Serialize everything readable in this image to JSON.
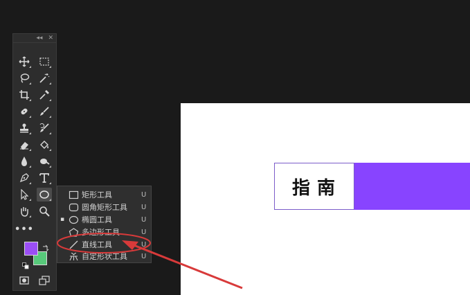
{
  "colors": {
    "app_bg": "#1a1a1a",
    "panel": "#2d2d2d",
    "foreground": "#9b4ef5",
    "background": "#57c97a",
    "canvas": "#ffffff",
    "purple_bar": "#8844ff",
    "annotation": "#d83a3a"
  },
  "toolbox": {
    "collapse_icon": "double-arrow-icon",
    "close_icon": "close-icon",
    "tools": [
      "move-icon",
      "marquee-icon",
      "lasso-icon",
      "magic-wand-icon",
      "crop-icon",
      "eyedropper-icon",
      "healing-brush-icon",
      "brush-icon",
      "stamp-icon",
      "history-brush-icon",
      "eraser-icon",
      "paint-bucket-icon",
      "blur-icon",
      "dodge-icon",
      "pen-icon",
      "type-icon",
      "path-select-icon",
      "ellipse-icon",
      "hand-icon",
      "zoom-icon"
    ],
    "more": "•••"
  },
  "flyout": {
    "items": [
      {
        "label": "矩形工具",
        "shortcut": "U",
        "icon": "rectangle-icon",
        "selected": false
      },
      {
        "label": "圆角矩形工具",
        "shortcut": "U",
        "icon": "rounded-rectangle-icon",
        "selected": false
      },
      {
        "label": "椭圆工具",
        "shortcut": "U",
        "icon": "ellipse-icon",
        "selected": true,
        "mark": "▪"
      },
      {
        "label": "多边形工具",
        "shortcut": "U",
        "icon": "polygon-icon",
        "selected": false
      },
      {
        "label": "直线工具",
        "shortcut": "U",
        "icon": "line-icon",
        "selected": false
      },
      {
        "label": "自定形状工具",
        "shortcut": "U",
        "icon": "custom-shape-icon",
        "selected": false
      }
    ]
  },
  "canvas": {
    "title": "指南"
  }
}
